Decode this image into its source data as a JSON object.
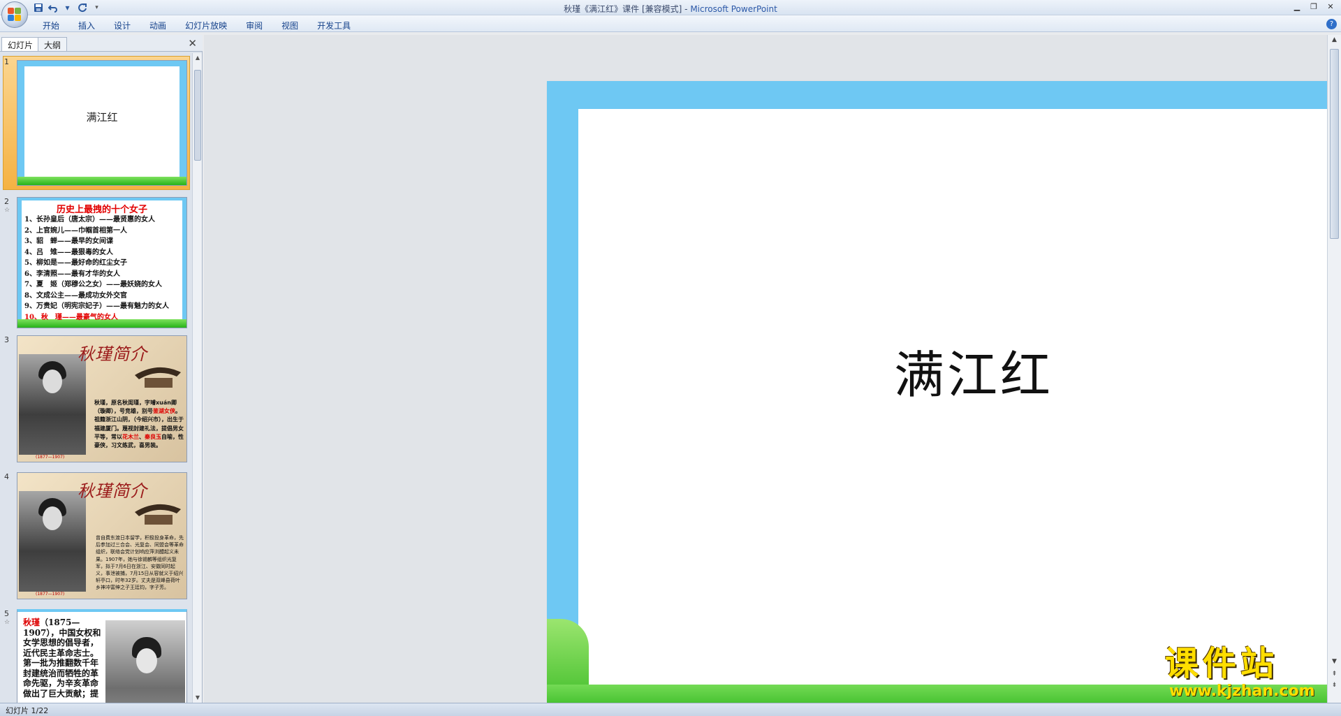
{
  "window": {
    "title_doc": "秋瑾《满江红》课件 [兼容模式] - ",
    "title_app": "Microsoft PowerPoint"
  },
  "quick_access": {
    "icons": [
      "save-icon",
      "undo-icon",
      "redo-icon",
      "customize-dropdown-icon"
    ]
  },
  "ribbon": {
    "tabs": [
      "开始",
      "插入",
      "设计",
      "动画",
      "幻灯片放映",
      "审阅",
      "视图",
      "开发工具"
    ]
  },
  "left_panel": {
    "tab_slides": "幻灯片",
    "tab_outline": "大纲",
    "close": "✕"
  },
  "thumbnails": {
    "s1": {
      "num": "1",
      "title": "满江红"
    },
    "s2": {
      "num": "2",
      "title": "历史上最拽的十个女子",
      "items": [
        "1、长孙皇后（唐太宗）——最贤惠的女人",
        "2、上官婉儿——巾帼首相第一人",
        "3、貂　蝉——最早的女间谍",
        "4、吕　雉——最狠毒的女人",
        "5、柳如是——最好命的红尘女子",
        "6、李清照——最有才华的女人",
        "7、夏　姬（郑穆公之女）——最妖娆的女人",
        "8、文成公主——最成功女外交官",
        "9、万贵妃（明宪宗妃子）——最有魅力的女人",
        "10、秋　瑾——最豪气的女人"
      ]
    },
    "s3": {
      "num": "3",
      "title": "秋瑾简介",
      "caption": "(1877—1907)",
      "text_a": "秋瑾，原名秋闺瑾，字璿xuán卿（璇卿），号竞雄，别号",
      "text_red1": "鉴湖女侠",
      "text_b": "。祖籍浙江山阴，（今绍兴市），出生于福建厦门。蔑视封建礼法，提倡男女平等，常以",
      "text_red2": "花木兰",
      "text_c": "、",
      "text_red3": "秦良玉",
      "text_d": "自喻，性豪侠，习文练武，喜男装。"
    },
    "s4": {
      "num": "4",
      "title": "秋瑾简介",
      "caption": "(1877—1907)",
      "text": "曾自费东渡日本留学，积极投身革命，先后参加过三合会、光复会、同盟会等革命组织，联络会党计划响应萍浏醴起义未果。1907年，她与徐锡麟等组织光复军，拟于7月6日在浙江、安徽同时起义，事泄被捕，7月15日从容就义于绍兴轩亭口，时年32岁。丈夫是双峰县荷叶乡神冲富绅之子王廷钧，字子芳。"
    },
    "s5": {
      "num": "5",
      "name_red": "秋瑾",
      "text": "（1875—1907），中国女权和女学思想的倡导者，近代民主革命志士。第一批为推翻数千年封建统治而牺牲的革命先驱，为辛亥革命做出了巨大贡献；提"
    }
  },
  "slide": {
    "title": "满江红"
  },
  "watermark": {
    "text": "课件站",
    "url": "www.kjzhan.com"
  },
  "status": {
    "text": "幻灯片 1/22"
  }
}
